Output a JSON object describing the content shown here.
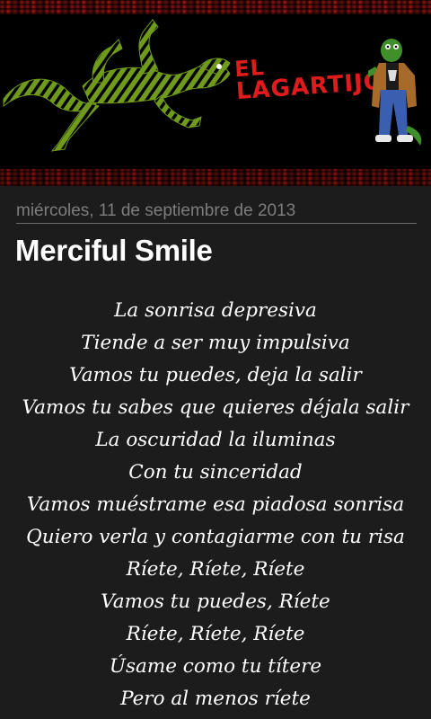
{
  "header": {
    "brand_line1": "EL",
    "brand_line2": "LAGARTIJO"
  },
  "post": {
    "date": "miércoles, 11 de septiembre de 2013",
    "title": "Merciful Smile",
    "lines": [
      "La sonrisa depresiva",
      "Tiende a ser muy impulsiva",
      "Vamos tu puedes, deja la salir",
      "Vamos tu sabes que quieres déjala salir",
      "La oscuridad la iluminas",
      "Con tu sinceridad",
      "Vamos muéstrame esa piadosa sonrisa",
      "Quiero verla y contagiarme con tu risa",
      "Ríete, Ríete, Ríete",
      "Vamos tu puedes, Ríete",
      "Ríete, Ríete, Ríete",
      "Úsame como tu títere",
      "Pero al menos ríete"
    ]
  },
  "colors": {
    "background": "#1c1c1c",
    "brand_red": "#e01b1b",
    "lizard_green": "#6f9a1c",
    "date_gray": "#7d7d7d"
  }
}
